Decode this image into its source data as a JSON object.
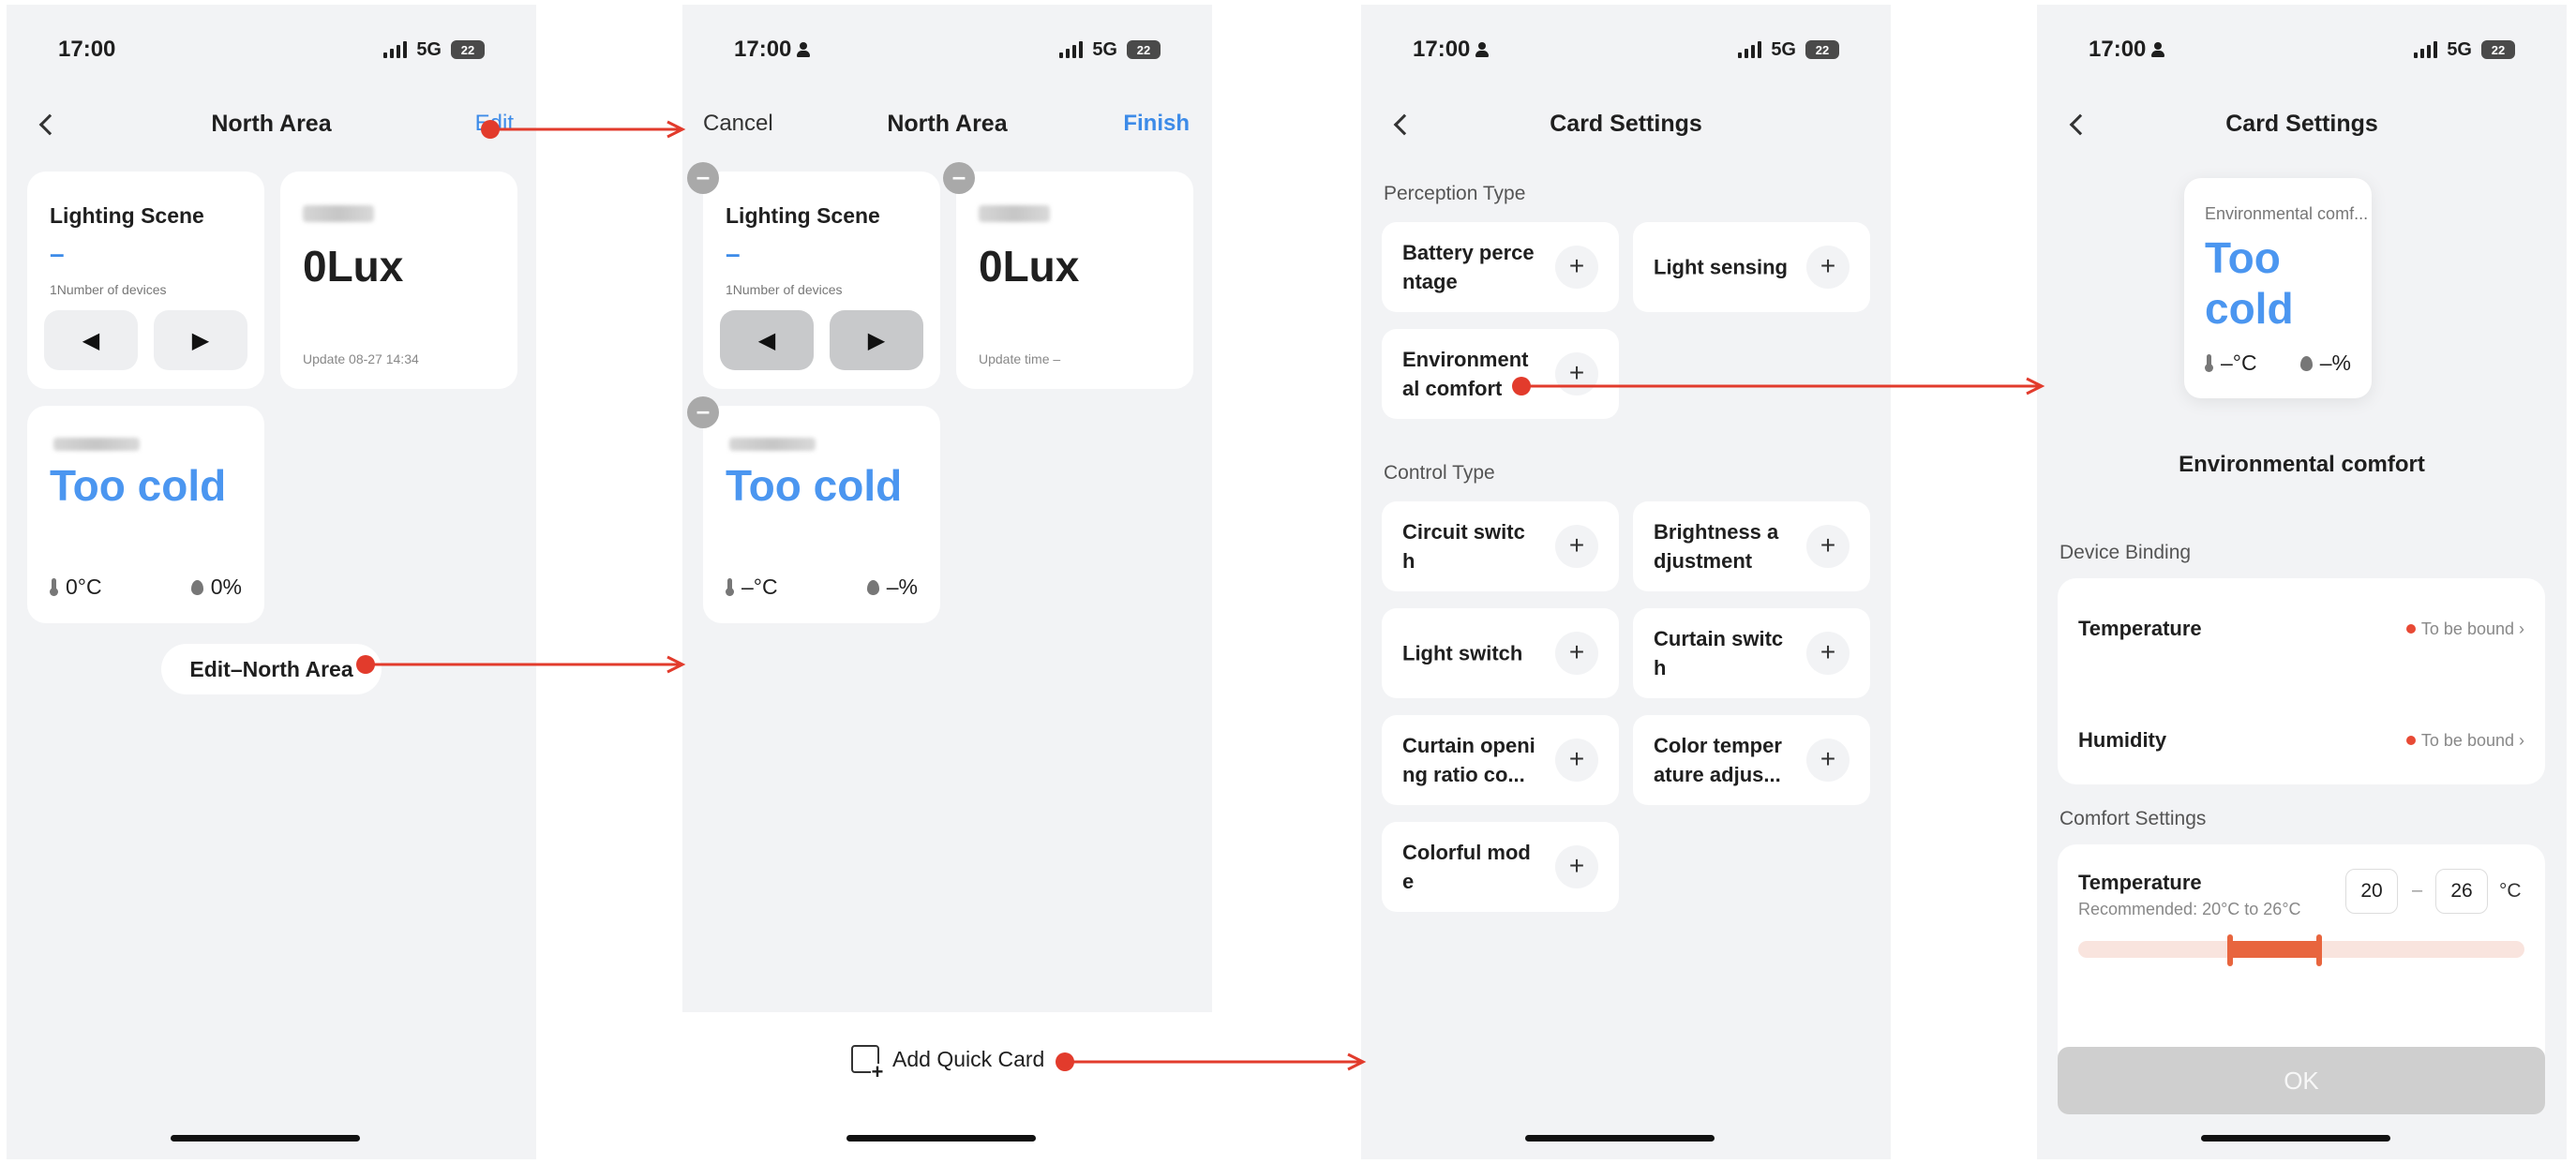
{
  "status_bar": {
    "time": "17:00",
    "network": "5G",
    "battery": "22"
  },
  "screen1": {
    "title": "North Area",
    "edit_label": "Edit",
    "lighting": {
      "title": "Lighting Scene",
      "value": "–",
      "devices": "1Number of devices",
      "prev": "◀",
      "next": "▶"
    },
    "lux": {
      "value": "0Lux",
      "update": "Update 08-27 14:34"
    },
    "env": {
      "status": "Too cold",
      "temp": "0°C",
      "humidity": "0%"
    },
    "edit_pill": "Edit–North Area"
  },
  "screen2": {
    "cancel_label": "Cancel",
    "title": "North Area",
    "finish_label": "Finish",
    "lighting": {
      "title": "Lighting Scene",
      "value": "–",
      "devices": "1Number of devices",
      "prev": "◀",
      "next": "▶"
    },
    "lux": {
      "value": "0Lux",
      "update": "Update time –"
    },
    "env": {
      "status": "Too cold",
      "temp": "–°C",
      "humidity": "–%"
    },
    "minus_symbol": "–",
    "add_quick_card": "Add Quick Card"
  },
  "screen3": {
    "title": "Card Settings",
    "perception_label": "Perception Type",
    "perception_items": [
      "Battery perce ntage",
      "Light sensing",
      "Environment al comfort"
    ],
    "control_label": "Control Type",
    "control_items": [
      "Circuit switc h",
      "Brightness a djustment",
      "Light switch",
      "Curtain switc h",
      "Curtain openi ng ratio co...",
      "Color temper ature adjus...",
      "Colorful mod e"
    ],
    "plus_symbol": "+"
  },
  "screen4": {
    "title": "Card Settings",
    "preview": {
      "title": "Environmental comf...",
      "status": "Too cold",
      "temp": "–°C",
      "humidity": "–%"
    },
    "card_name": "Environmental comfort",
    "binding_label": "Device Binding",
    "binding": [
      {
        "label": "Temperature",
        "status": "To be bound ›"
      },
      {
        "label": "Humidity",
        "status": "To be bound ›"
      }
    ],
    "comfort_label": "Comfort Settings",
    "comfort": {
      "label": "Temperature",
      "hint": "Recommended: 20°C to 26°C",
      "min": "20",
      "sep": "–",
      "max": "26",
      "unit": "°C",
      "range_start_pct": 34,
      "range_end_pct": 54
    },
    "ok_label": "OK"
  },
  "colors": {
    "accent_blue": "#3d8be8",
    "arrow_red": "#e23b2c",
    "slider_orange": "#e8653e"
  }
}
